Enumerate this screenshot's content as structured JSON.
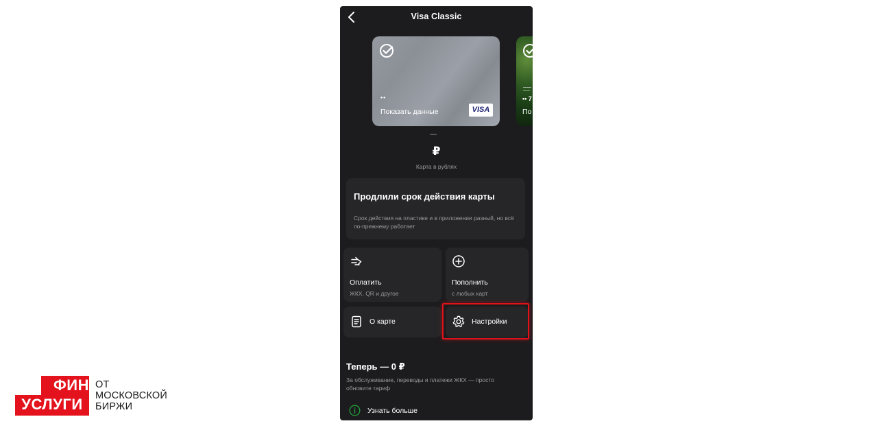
{
  "header": {
    "title": "Visa Classic",
    "back_icon": "chevron-left-icon"
  },
  "cards": [
    {
      "dots": "••",
      "label": "Показать данные",
      "brand": "VISA",
      "check_icon": "sber-check-icon",
      "color": "#8f949b"
    },
    {
      "dots": "•• 7",
      "label": "По",
      "check_icon": "sber-check-icon",
      "color": "#2f5a22"
    }
  ],
  "currency": {
    "sign": "₽",
    "label": "Карта в рублях"
  },
  "promo": {
    "title": "Продлили срок действия карты",
    "text": "Срок действия на пластике и в приложении разный, но всё по-прежнему работает"
  },
  "actions": {
    "pay": {
      "label": "Оплатить",
      "sub": "ЖКХ, QR и другое",
      "icon": "pay-arrow-icon"
    },
    "topup": {
      "label": "Пополнить",
      "sub": "с любых карт",
      "icon": "plus-circle-icon"
    },
    "about": {
      "label": "О карте",
      "icon": "document-icon"
    },
    "settings": {
      "label": "Настройки",
      "icon": "gear-icon"
    }
  },
  "tariff": {
    "title": "Теперь — 0 ₽",
    "text": "За обслуживание, переводы и платежи ЖКХ — просто обновите тариф",
    "link": "Узнать больше",
    "link_icon": "info-icon"
  },
  "logo": {
    "line1": "ФИН",
    "line2": "УСЛУГИ",
    "caption1": "ОТ",
    "caption2": "МОСКОВСКОЙ",
    "caption3": "БИРЖИ"
  },
  "colors": {
    "background": "#1c1c1e",
    "tile": "#262628",
    "accent_green": "#21a038",
    "highlight": "#e0121a",
    "logo_red": "#e3121c"
  }
}
